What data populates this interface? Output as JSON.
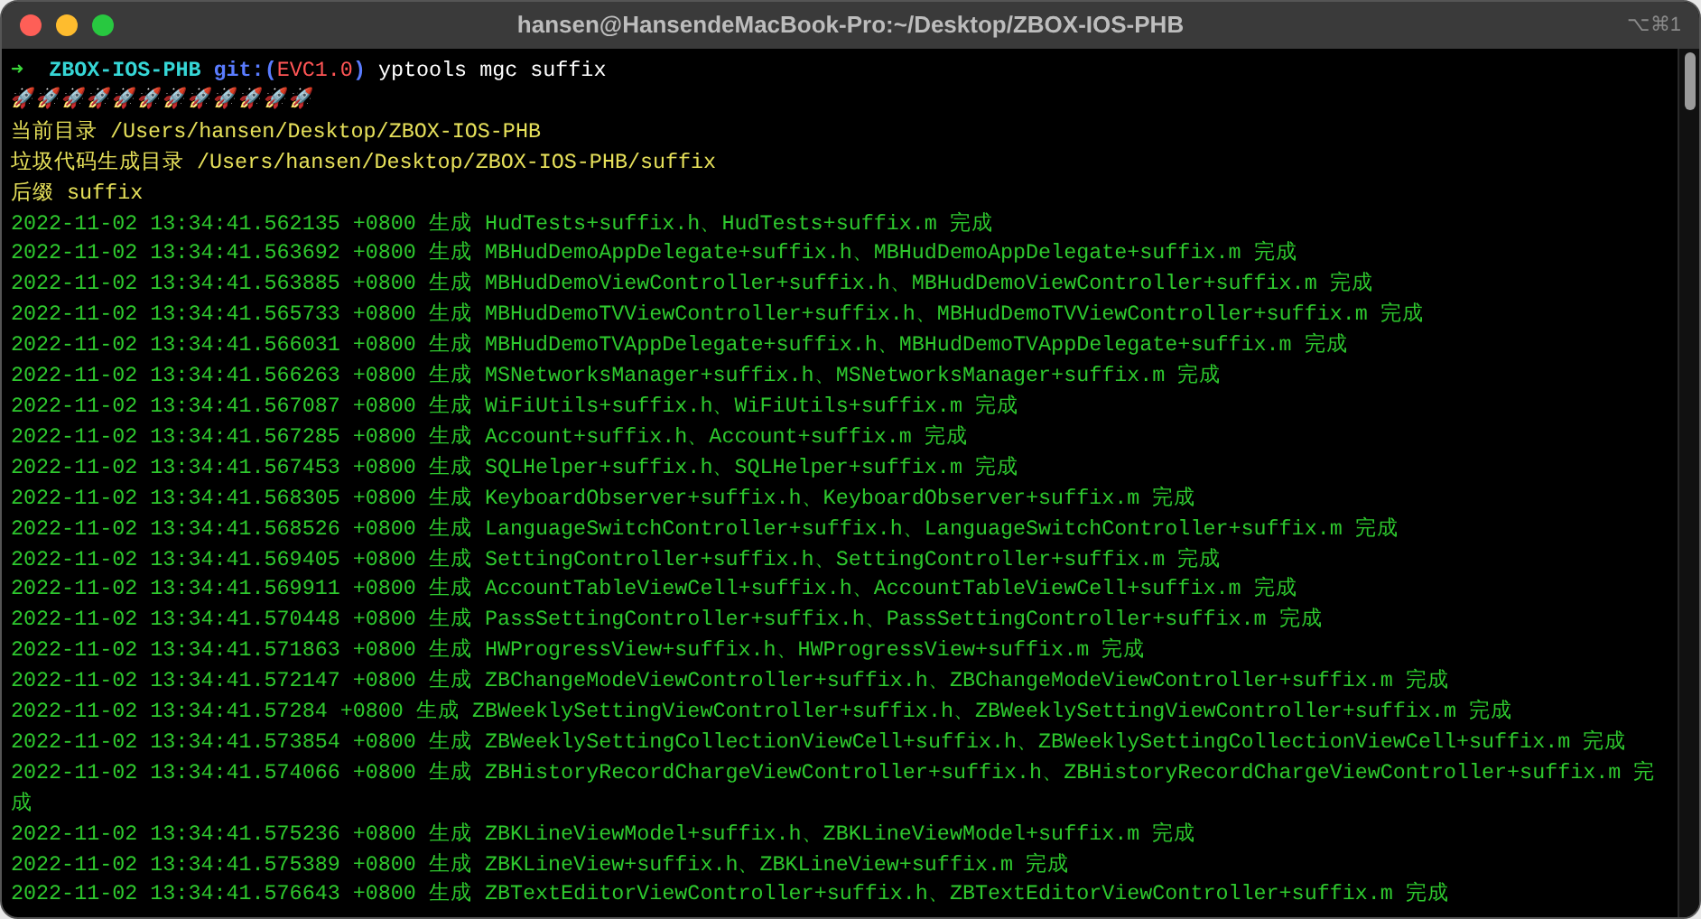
{
  "window": {
    "title": "hansen@HansendeMacBook-Pro:~/Desktop/ZBOX-IOS-PHB",
    "shortcut": "⌥⌘1"
  },
  "prompt": {
    "arrow": "➜",
    "directory": "ZBOX-IOS-PHB",
    "git_open": "git:(",
    "branch": "EVC1.0",
    "git_close": ")",
    "command": "yptools mgc suffix"
  },
  "rockets": "🚀🚀🚀🚀🚀🚀🚀🚀🚀🚀🚀🚀",
  "info_lines": [
    "当前目录 /Users/hansen/Desktop/ZBOX-IOS-PHB",
    "垃圾代码生成目录 /Users/hansen/Desktop/ZBOX-IOS-PHB/suffix",
    "后缀 suffix"
  ],
  "log_lines": [
    "2022-11-02 13:34:41.562135 +0800 生成 HudTests+suffix.h、HudTests+suffix.m 完成",
    "2022-11-02 13:34:41.563692 +0800 生成 MBHudDemoAppDelegate+suffix.h、MBHudDemoAppDelegate+suffix.m 完成",
    "2022-11-02 13:34:41.563885 +0800 生成 MBHudDemoViewController+suffix.h、MBHudDemoViewController+suffix.m 完成",
    "2022-11-02 13:34:41.565733 +0800 生成 MBHudDemoTVViewController+suffix.h、MBHudDemoTVViewController+suffix.m 完成",
    "2022-11-02 13:34:41.566031 +0800 生成 MBHudDemoTVAppDelegate+suffix.h、MBHudDemoTVAppDelegate+suffix.m 完成",
    "2022-11-02 13:34:41.566263 +0800 生成 MSNetworksManager+suffix.h、MSNetworksManager+suffix.m 完成",
    "2022-11-02 13:34:41.567087 +0800 生成 WiFiUtils+suffix.h、WiFiUtils+suffix.m 完成",
    "2022-11-02 13:34:41.567285 +0800 生成 Account+suffix.h、Account+suffix.m 完成",
    "2022-11-02 13:34:41.567453 +0800 生成 SQLHelper+suffix.h、SQLHelper+suffix.m 完成",
    "2022-11-02 13:34:41.568305 +0800 生成 KeyboardObserver+suffix.h、KeyboardObserver+suffix.m 完成",
    "2022-11-02 13:34:41.568526 +0800 生成 LanguageSwitchController+suffix.h、LanguageSwitchController+suffix.m 完成",
    "2022-11-02 13:34:41.569405 +0800 生成 SettingController+suffix.h、SettingController+suffix.m 完成",
    "2022-11-02 13:34:41.569911 +0800 生成 AccountTableViewCell+suffix.h、AccountTableViewCell+suffix.m 完成",
    "2022-11-02 13:34:41.570448 +0800 生成 PassSettingController+suffix.h、PassSettingController+suffix.m 完成",
    "2022-11-02 13:34:41.571863 +0800 生成 HWProgressView+suffix.h、HWProgressView+suffix.m 完成",
    "2022-11-02 13:34:41.572147 +0800 生成 ZBChangeModeViewController+suffix.h、ZBChangeModeViewController+suffix.m 完成",
    "2022-11-02 13:34:41.57284 +0800 生成 ZBWeeklySettingViewController+suffix.h、ZBWeeklySettingViewController+suffix.m 完成",
    "2022-11-02 13:34:41.573854 +0800 生成 ZBWeeklySettingCollectionViewCell+suffix.h、ZBWeeklySettingCollectionViewCell+suffix.m 完成",
    "2022-11-02 13:34:41.574066 +0800 生成 ZBHistoryRecordChargeViewController+suffix.h、ZBHistoryRecordChargeViewController+suffix.m 完",
    "成",
    "2022-11-02 13:34:41.575236 +0800 生成 ZBKLineViewModel+suffix.h、ZBKLineViewModel+suffix.m 完成",
    "2022-11-02 13:34:41.575389 +0800 生成 ZBKLineView+suffix.h、ZBKLineView+suffix.m 完成",
    "2022-11-02 13:34:41.576643 +0800 生成 ZBTextEditorViewController+suffix.h、ZBTextEditorViewController+suffix.m 完成"
  ]
}
